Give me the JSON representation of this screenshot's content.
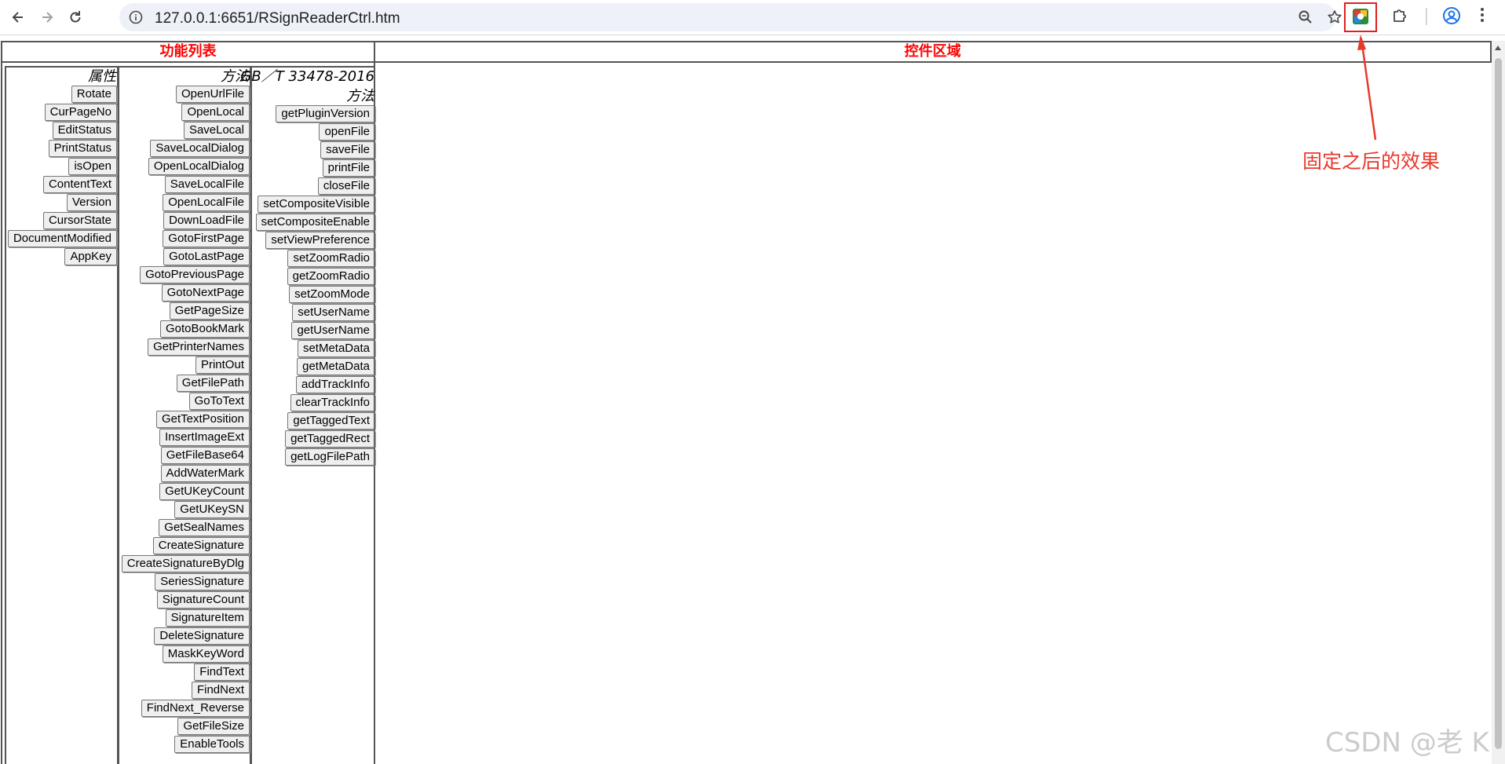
{
  "browser": {
    "url": "127.0.0.1:6651/RSignReaderCtrl.htm"
  },
  "headers": {
    "function_list": "功能列表",
    "control_area": "控件区域"
  },
  "columns": {
    "properties": {
      "title": "属性",
      "items": [
        "Rotate",
        "CurPageNo",
        "EditStatus",
        "PrintStatus",
        "isOpen",
        "ContentText",
        "Version",
        "CursorState",
        "DocumentModified",
        "AppKey"
      ]
    },
    "methods": {
      "title": "方法",
      "items": [
        "OpenUrlFile",
        "OpenLocal",
        "SaveLocal",
        "SaveLocalDialog",
        "OpenLocalDialog",
        "SaveLocalFile",
        "OpenLocalFile",
        "DownLoadFile",
        "GotoFirstPage",
        "GotoLastPage",
        "GotoPreviousPage",
        "GotoNextPage",
        "GetPageSize",
        "GotoBookMark",
        "GetPrinterNames",
        "PrintOut",
        "GetFilePath",
        "GoToText",
        "GetTextPosition",
        "InsertImageExt",
        "GetFileBase64",
        "AddWaterMark",
        "GetUKeyCount",
        "GetUKeySN",
        "GetSealNames",
        "CreateSignature",
        "CreateSignatureByDlg",
        "SeriesSignature",
        "SignatureCount",
        "SignatureItem",
        "DeleteSignature",
        "MaskKeyWord",
        "FindText",
        "FindNext",
        "FindNext_Reverse",
        "GetFileSize",
        "EnableTools"
      ]
    },
    "gb_methods": {
      "title_line1": "GB／T 33478-2016",
      "title_line2": "方法",
      "items": [
        "getPluginVersion",
        "openFile",
        "saveFile",
        "printFile",
        "closeFile",
        "setCompositeVisible",
        "setCompositeEnable",
        "setViewPreference",
        "setZoomRadio",
        "getZoomRadio",
        "setZoomMode",
        "setUserName",
        "getUserName",
        "setMetaData",
        "getMetaData",
        "addTrackInfo",
        "clearTrackInfo",
        "getTaggedText",
        "getTaggedRect",
        "getLogFilePath"
      ]
    }
  },
  "annotation": {
    "text": "固定之后的效果",
    "color": "#e8392c"
  },
  "watermark": "CSDN @老 K",
  "colors": {
    "header_text": "#ff0000",
    "highlight_box": "#e02020"
  },
  "icons": {
    "back": "back-arrow-icon",
    "forward": "forward-arrow-icon",
    "reload": "reload-icon",
    "site_info": "site-info-icon",
    "zoom": "zoom-icon",
    "bookmark": "star-icon",
    "extension": "extension-app-icon",
    "extensions_menu": "puzzle-icon",
    "profile": "profile-icon",
    "menu": "kebab-menu-icon"
  }
}
